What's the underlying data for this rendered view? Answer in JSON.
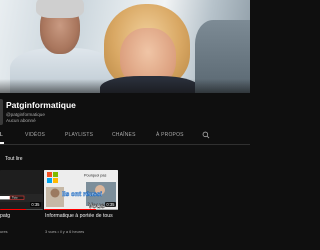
{
  "channel": {
    "name": "Patginformatique",
    "handle": "@patginformatique",
    "subscribers": "Aucun abonné"
  },
  "tabs": [
    {
      "label": "L",
      "active": true
    },
    {
      "label": "VIDÉOS"
    },
    {
      "label": "PLAYLISTS"
    },
    {
      "label": "CHAÎNES"
    },
    {
      "label": "À PROPOS"
    }
  ],
  "section": {
    "title": "Tout lire"
  },
  "videos": [
    {
      "title": "patg",
      "meta": "ures",
      "duration": "0:35",
      "watched_fraction": 0.6,
      "thumb_badge": "Tuto"
    },
    {
      "title": "Informatique à portée de tous",
      "meta": "3 vues • il y a 6 heures",
      "duration": "0:35",
      "watched_fraction": 0.7,
      "thumb_top_text": "Pourquoi pas",
      "thumb_big_text": "Ils ont réussi",
      "thumb_bottom_text": "Vous"
    }
  ],
  "colors": {
    "background": "#0f0f0f",
    "text_primary": "#f1f1f1",
    "text_secondary": "#aaaaaa",
    "progress": "#ff0000"
  },
  "icons": [
    "search-icon"
  ]
}
